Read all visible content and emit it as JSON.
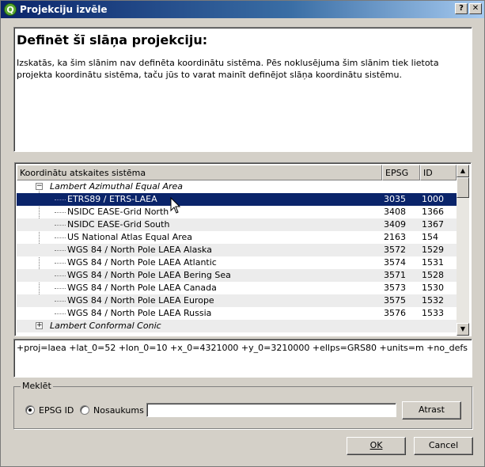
{
  "window": {
    "title": "Projekciju izvēle",
    "title_icon": "Q",
    "help_label": "?",
    "close_label": "✕"
  },
  "info": {
    "heading": "Definēt šī slāņa projekciju:",
    "description": "Izskatās, ka šim slānim nav definēta koordinātu sistēma. Pēs noklusējuma šim slānim tiek lietota projekta koordinātu sistēma, taču jūs to varat mainīt definējot slāņa koordinātu sistēmu."
  },
  "table": {
    "columns": [
      "Koordinātu atskaites sistēma",
      "EPSG",
      "ID"
    ],
    "groups": [
      {
        "name": "Lambert Azimuthal Equal Area",
        "expanded": true,
        "rows": [
          {
            "name": "ETRS89 / ETRS-LAEA",
            "epsg": "3035",
            "id": "1000",
            "selected": true
          },
          {
            "name": "NSIDC EASE-Grid North",
            "epsg": "3408",
            "id": "1366"
          },
          {
            "name": "NSIDC EASE-Grid South",
            "epsg": "3409",
            "id": "1367"
          },
          {
            "name": "US National Atlas Equal Area",
            "epsg": "2163",
            "id": "154"
          },
          {
            "name": "WGS 84 / North Pole LAEA Alaska",
            "epsg": "3572",
            "id": "1529"
          },
          {
            "name": "WGS 84 / North Pole LAEA Atlantic",
            "epsg": "3574",
            "id": "1531"
          },
          {
            "name": "WGS 84 / North Pole LAEA Bering Sea",
            "epsg": "3571",
            "id": "1528"
          },
          {
            "name": "WGS 84 / North Pole LAEA Canada",
            "epsg": "3573",
            "id": "1530"
          },
          {
            "name": "WGS 84 / North Pole LAEA Europe",
            "epsg": "3575",
            "id": "1532"
          },
          {
            "name": "WGS 84 / North Pole LAEA Russia",
            "epsg": "3576",
            "id": "1533"
          }
        ]
      },
      {
        "name": "Lambert Conformal Conic",
        "expanded": false,
        "rows": []
      }
    ]
  },
  "proj_string": "+proj=laea +lat_0=52 +lon_0=10 +x_0=4321000 +y_0=3210000 +ellps=GRS80 +units=m +no_defs",
  "search": {
    "group_label": "Meklēt",
    "option_epsg": "EPSG ID",
    "option_name": "Nosaukums",
    "selected_option": "EPSG ID",
    "input_value": "",
    "find_button": "Atrast"
  },
  "buttons": {
    "ok": "OK",
    "cancel": "Cancel"
  }
}
